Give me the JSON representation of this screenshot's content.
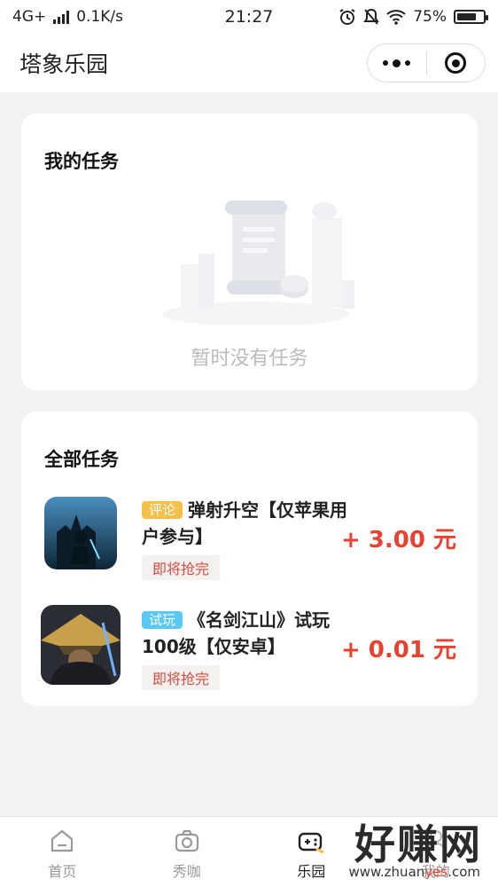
{
  "status_bar": {
    "network": "4G+",
    "speed": "0.1K/s",
    "time": "21:27",
    "battery": "75%",
    "battery_level": 0.75
  },
  "nav": {
    "title": "塔象乐园"
  },
  "my_tasks": {
    "title": "我的任务",
    "empty_text": "暂时没有任务"
  },
  "all_tasks": {
    "title": "全部任务",
    "items": [
      {
        "tag": "评论",
        "title": "弹射升空【仅苹果用户参与】",
        "status": "即将抢完",
        "reward": "+ 3.00 元"
      },
      {
        "tag": "试玩",
        "title": "《名剑江山》试玩100级【仅安卓】",
        "status": "即将抢完",
        "reward": "+ 0.01 元"
      }
    ]
  },
  "tabbar": {
    "items": [
      {
        "label": "首页",
        "icon": "home-icon"
      },
      {
        "label": "秀咖",
        "icon": "camera-icon"
      },
      {
        "label": "乐园",
        "icon": "gamepad-icon"
      },
      {
        "label": "我的",
        "icon": "user-icon"
      }
    ]
  },
  "watermark": {
    "main": "好赚网",
    "sub_prefix": "www.zhuan",
    "sub_accent": "yes",
    "sub_suffix": ".com"
  },
  "colors": {
    "accent_red": "#e8412f",
    "tag_review": "#f5c04a",
    "tag_trial": "#5ac8f5"
  }
}
